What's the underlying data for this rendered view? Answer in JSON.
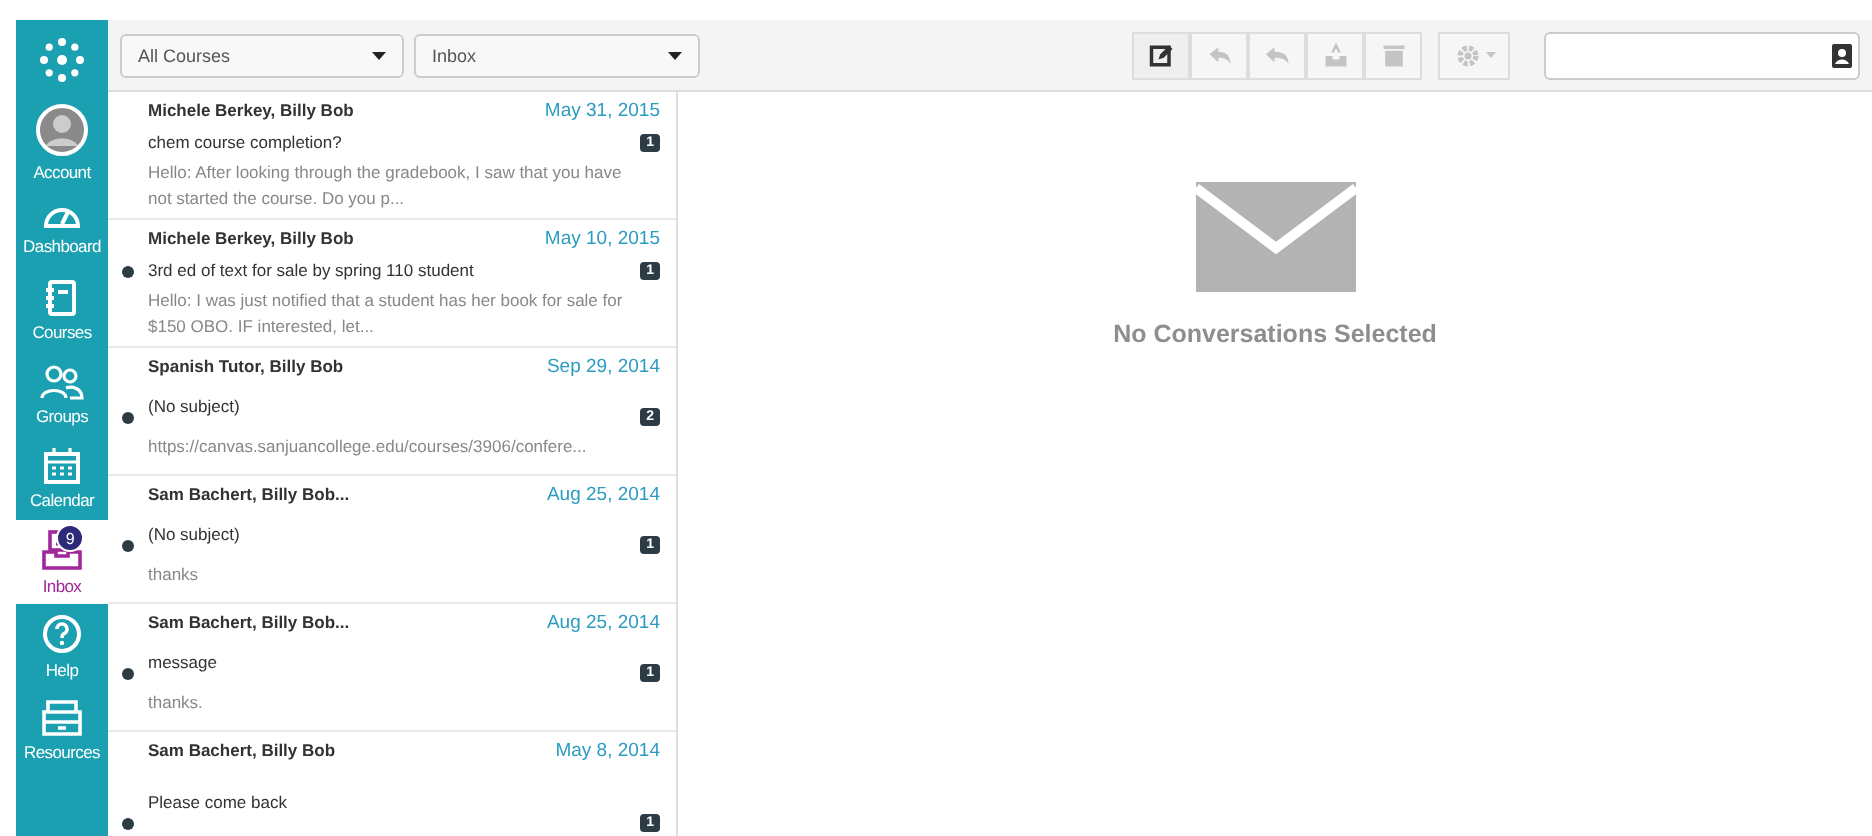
{
  "nav": {
    "items": [
      {
        "kind": "account",
        "label": "Account",
        "selected": false
      },
      {
        "kind": "dashboard",
        "label": "Dashboard",
        "selected": false
      },
      {
        "kind": "courses",
        "label": "Courses",
        "selected": false
      },
      {
        "kind": "groups",
        "label": "Groups",
        "selected": false
      },
      {
        "kind": "calendar",
        "label": "Calendar",
        "selected": false
      },
      {
        "kind": "inbox",
        "label": "Inbox",
        "selected": true,
        "badge": "9"
      },
      {
        "kind": "help",
        "label": "Help",
        "selected": false
      },
      {
        "kind": "resources",
        "label": "Resources",
        "selected": false
      }
    ]
  },
  "filters": [
    {
      "value": "All Courses"
    },
    {
      "value": "Inbox"
    }
  ],
  "toolbar": {
    "buttons": [
      {
        "kind": "compose",
        "disabled": false
      },
      {
        "kind": "reply",
        "disabled": true
      },
      {
        "kind": "reply-all",
        "disabled": true
      },
      {
        "kind": "archive",
        "disabled": true
      },
      {
        "kind": "delete",
        "disabled": true
      },
      {
        "kind": "settings",
        "disabled": true
      }
    ]
  },
  "conversations": [
    {
      "participants": "Michele Berkey, Billy Bob",
      "date": "May 31, 2015",
      "subject": "chem course completion?",
      "preview": "Hello: After looking through the gradebook, I saw that you have not started the course. Do you p...",
      "count": "1",
      "unread": false
    },
    {
      "participants": "Michele Berkey, Billy Bob",
      "date": "May 10, 2015",
      "subject": "3rd ed of text for sale by spring 110 student",
      "preview": "Hello: I was just notified that a student has her book for sale for $150 OBO. IF interested, let...",
      "count": "1",
      "unread": true
    },
    {
      "participants": "Spanish Tutor, Billy Bob",
      "date": "Sep 29, 2014",
      "subject": "(No subject)",
      "preview": "https://canvas.sanjuancollege.edu/courses/3906/confere...",
      "count": "2",
      "unread": true
    },
    {
      "participants": "Sam Bachert, Billy Bob...",
      "date": "Aug 25, 2014",
      "subject": "(No subject)",
      "preview": "thanks",
      "count": "1",
      "unread": true
    },
    {
      "participants": "Sam Bachert, Billy Bob...",
      "date": "Aug 25, 2014",
      "subject": "message",
      "preview": "thanks.",
      "count": "1",
      "unread": true
    },
    {
      "participants": "Sam Bachert, Billy Bob",
      "date": "May 8, 2014",
      "subject": "Please come back",
      "count": "1",
      "unread": true
    }
  ],
  "detail": {
    "empty_message": "No Conversations Selected"
  }
}
